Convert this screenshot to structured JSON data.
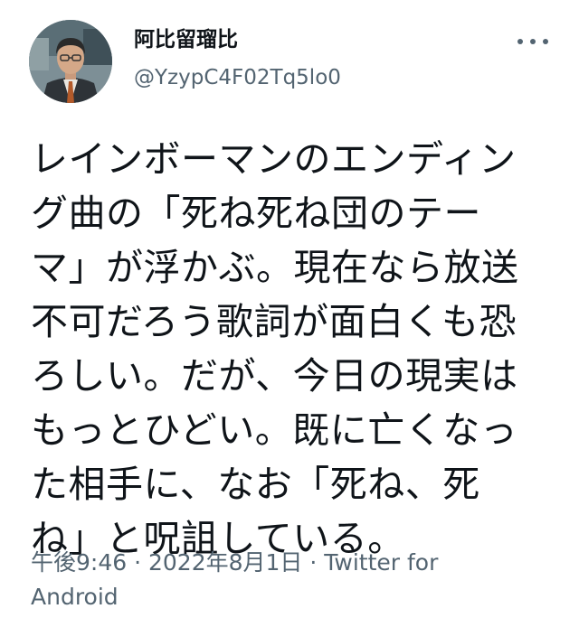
{
  "author": {
    "display_name": "阿比留瑠比",
    "handle": "@YzypC4F02Tq5lo0",
    "avatar_icon": "profile-photo"
  },
  "menu": {
    "more_icon": "more-horizontal-icon"
  },
  "tweet": {
    "lines": [
      "レインボーマンのエンディン",
      "グ曲の「死ね死ね団のテー",
      "マ」が浮かぶ。現在なら放送",
      "不可だろう歌詞が面白くも恐",
      "ろしい。だが、今日の現実は",
      "もっとひどい。既に亡くなっ",
      "た相手に、なお「死ね、死",
      "ね」と呪詛している。"
    ]
  },
  "meta": {
    "line1": "午後9:46 · 2022年8月1日 · Twitter for",
    "line2": "Android"
  },
  "colors": {
    "text": "#0f1419",
    "secondary": "#536471",
    "background": "#ffffff"
  }
}
